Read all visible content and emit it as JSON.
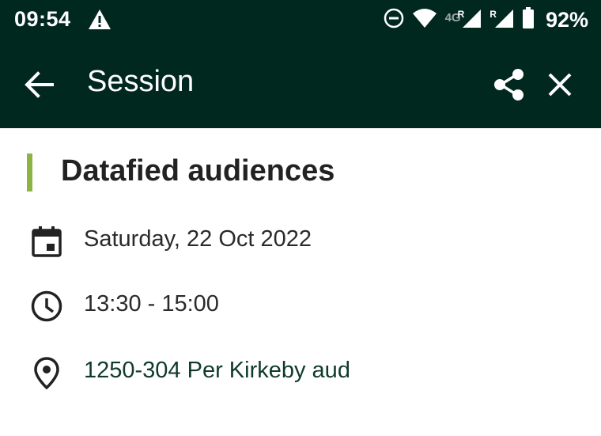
{
  "status_bar": {
    "time": "09:54",
    "network_label": "4G",
    "roaming_1": "R",
    "roaming_2": "R",
    "battery": "92%",
    "icons": [
      "alert-triangle-icon",
      "do-not-disturb-icon",
      "wifi-icon",
      "signal-icon",
      "signal-icon",
      "battery-icon"
    ]
  },
  "app_bar": {
    "title": "Session",
    "background": "#01281f",
    "icons": [
      "back-arrow-icon",
      "share-icon",
      "close-icon"
    ]
  },
  "session": {
    "title": "Datafied audiences",
    "accent_color": "#8bb443",
    "date": "Saturday, 22 Oct 2022",
    "time": "13:30 - 15:00",
    "location": "1250-304 Per Kirkeby aud"
  }
}
